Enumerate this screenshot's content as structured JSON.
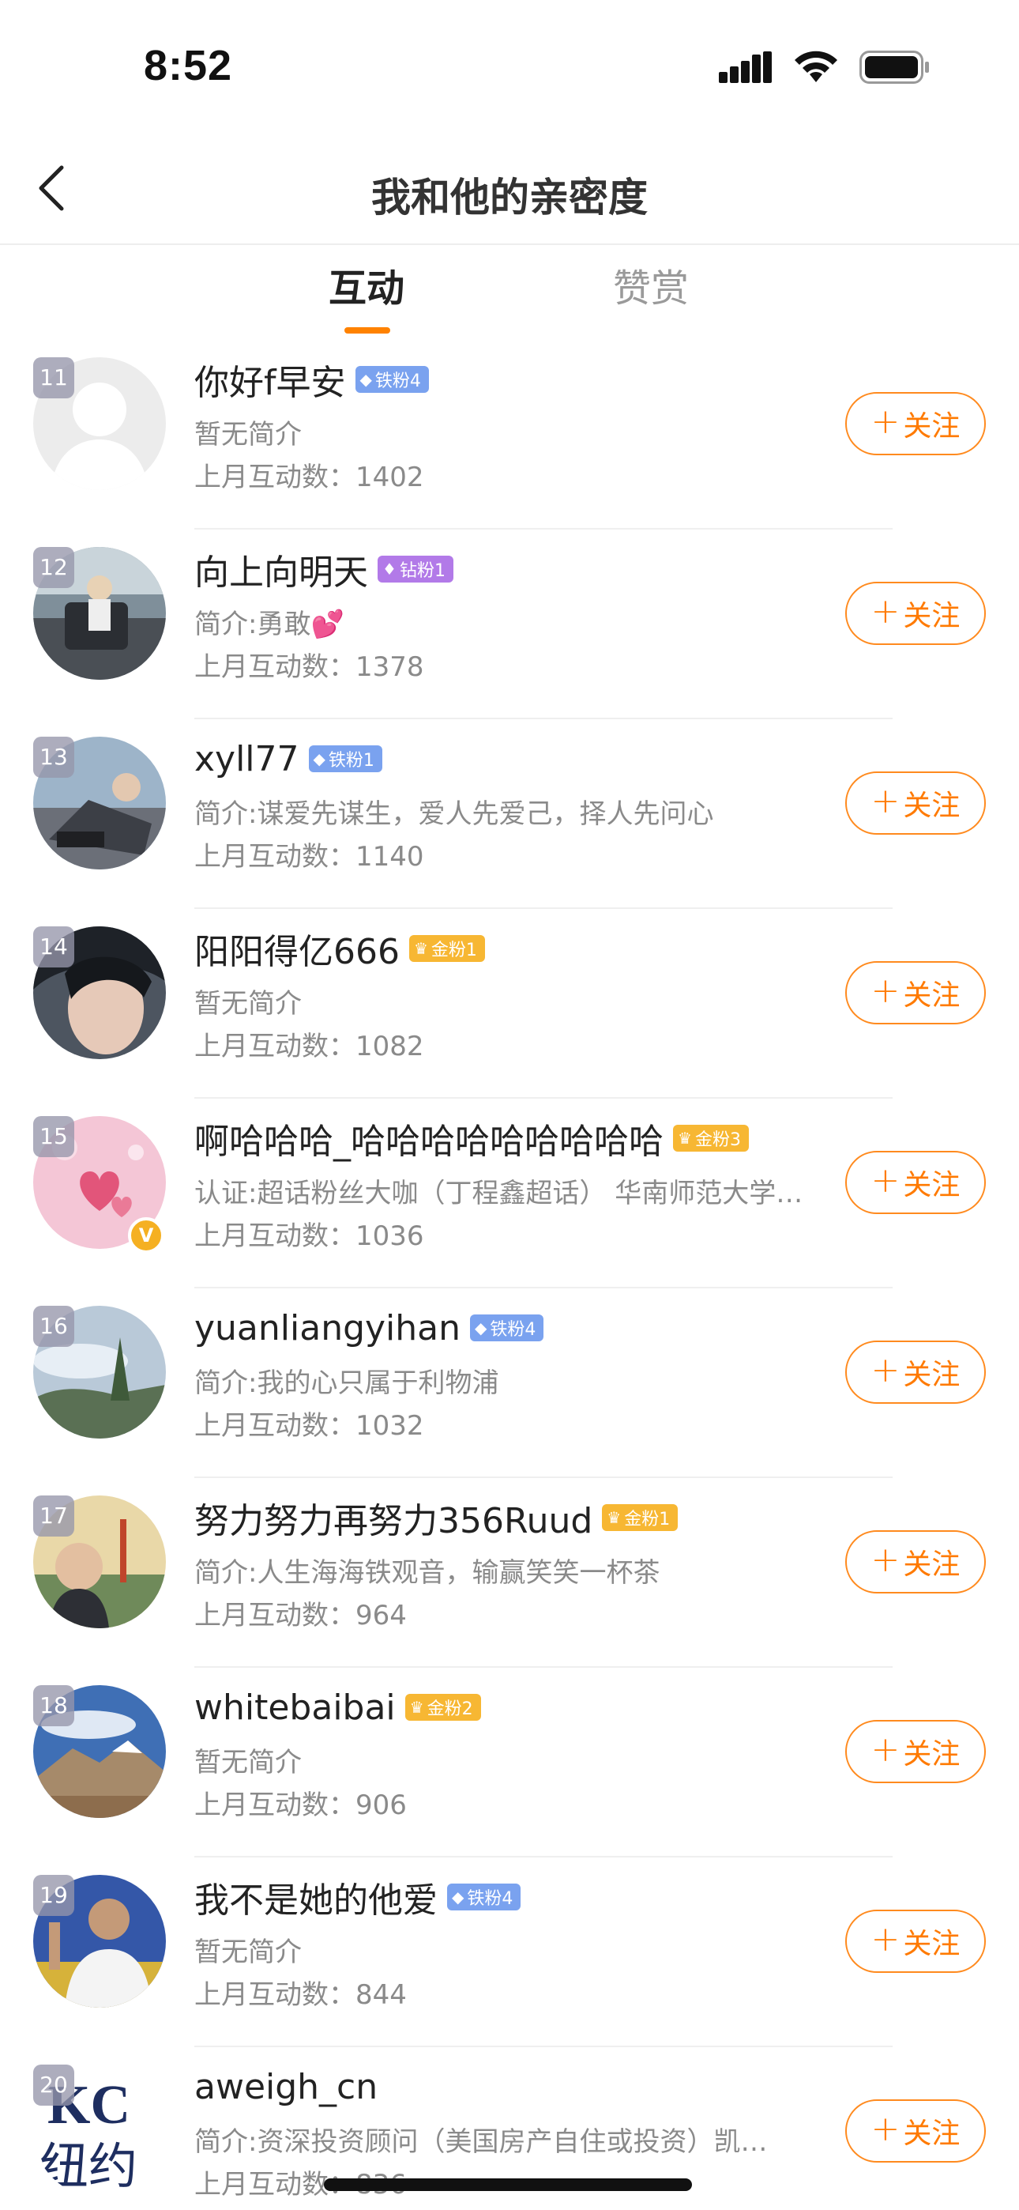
{
  "status_bar": {
    "time": "8:52",
    "icons": [
      "cellular-signal-icon",
      "wifi-icon",
      "battery-icon"
    ]
  },
  "nav": {
    "back_icon": "chevron-left-icon",
    "title": "我和他的亲密度"
  },
  "tabs": [
    {
      "label": "互动",
      "active": true
    },
    {
      "label": "赞赏",
      "active": false
    }
  ],
  "colors": {
    "accent": "#ff8200",
    "iron_badge": "#7aa2ef",
    "diamond_badge": "#b27ae8",
    "gold_badge": "#f7b733",
    "secondary_text": "#8a8a8a"
  },
  "rows": [
    {
      "rank": "11",
      "name": "你好f早安",
      "badge": "铁粉4",
      "badge_type": "iron",
      "bio": "暂无简介",
      "count": "上月互动数：1402",
      "follow": "关注",
      "avatar": "default-avatar"
    },
    {
      "rank": "12",
      "name": "向上向明天",
      "badge": "钻粉1",
      "badge_type": "diamond",
      "bio": "简介:勇敢💕",
      "count": "上月互动数：1378",
      "follow": "关注",
      "avatar": "street-photo"
    },
    {
      "rank": "13",
      "name": "xyll77",
      "badge": "铁粉1",
      "badge_type": "iron",
      "bio": "简介:谋爱先谋生，爱人先爱己，择人先问心",
      "count": "上月互动数：1140",
      "follow": "关注",
      "avatar": "outdoor-photo"
    },
    {
      "rank": "14",
      "name": "阳阳得亿666",
      "badge": "金粉1",
      "badge_type": "gold",
      "bio": "暂无简介",
      "count": "上月互动数：1082",
      "follow": "关注",
      "avatar": "portrait-photo"
    },
    {
      "rank": "15",
      "name": "啊哈哈哈_哈哈哈哈哈哈哈哈哈",
      "badge": "金粉3",
      "badge_type": "gold",
      "bio": "认证:超话粉丝大咖（丁程鑫超话） 华南师范大学…",
      "count": "上月互动数：1036",
      "follow": "关注",
      "avatar": "pink-hearts",
      "verified": true
    },
    {
      "rank": "16",
      "name": "yuanliangyihan",
      "badge": "铁粉4",
      "badge_type": "iron",
      "bio": "简介:我的心只属于利物浦",
      "count": "上月互动数：1032",
      "follow": "关注",
      "avatar": "sky-photo"
    },
    {
      "rank": "17",
      "name": "努力努力再努力356Ruud",
      "badge": "金粉1",
      "badge_type": "gold",
      "bio": "简介:人生海海铁观音，输赢笑笑一杯茶",
      "count": "上月互动数：964",
      "follow": "关注",
      "avatar": "bridge-photo"
    },
    {
      "rank": "18",
      "name": "whitebaibai",
      "badge": "金粉2",
      "badge_type": "gold",
      "bio": "暂无简介",
      "count": "上月互动数：906",
      "follow": "关注",
      "avatar": "mountain-photo"
    },
    {
      "rank": "19",
      "name": "我不是她的他爱",
      "badge": "铁粉4",
      "badge_type": "iron",
      "bio": "暂无简介",
      "count": "上月互动数：844",
      "follow": "关注",
      "avatar": "player-photo"
    },
    {
      "rank": "20",
      "name": "aweigh_cn",
      "badge": "",
      "badge_type": "none",
      "bio": "简介:资深投资顾问（美国房产自住或投资）凯…",
      "count": "上月互动数：836",
      "follow": "关注",
      "avatar": "kc-logo"
    }
  ]
}
